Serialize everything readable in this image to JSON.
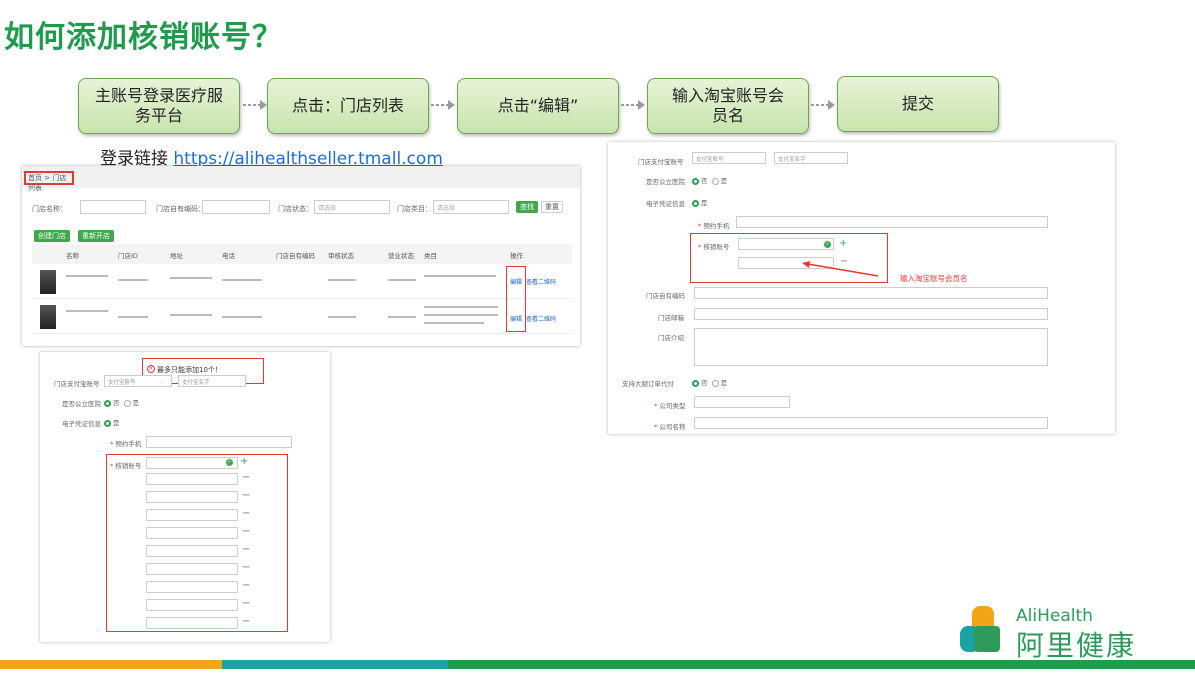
{
  "title": "如何添加核销账号？",
  "steps": [
    "主账号登录医疗服务平台",
    "点击：门店列表",
    "点击“编辑”",
    "输入淘宝账号会员名",
    "提交"
  ],
  "login": {
    "prefix": "登录链接 ",
    "url": "https://alihealthseller.tmall.com"
  },
  "store_list": {
    "breadcrumb": "首页 > 门店列表",
    "filters": {
      "name_label": "门店名称：",
      "code_label": "门店自有编码：",
      "status_label": "门店状态：",
      "status_placeholder": "请选择",
      "category_label": "门店类目：",
      "category_placeholder": "请选择",
      "search_button": "查找",
      "reset_button": "重置"
    },
    "actions": {
      "create": "创建门店",
      "reopen": "重新开店"
    },
    "columns": [
      "名称",
      "门店ID",
      "地址",
      "电话",
      "门店自有编码",
      "审核状态",
      "营业状态",
      "类目",
      "操作"
    ],
    "rows": [
      {
        "edit": "编辑",
        "qrcode": "查看二维码"
      },
      {
        "edit": "编辑",
        "qrcode": "查看二维码"
      }
    ]
  },
  "edit_form_left": {
    "tip": "最多只能添加10个！",
    "alipay_label": "门店支付宝账号",
    "alipay_placeholder": "支付宝账号",
    "alipay_name_placeholder": "支付宝名字",
    "public_hospital_label": "是否公立医院",
    "option_no": "否",
    "option_yes": "是",
    "evoucher_label": "电子凭证信息",
    "phone_label": "预约手机",
    "verify_label": "核销账号"
  },
  "edit_form_right": {
    "alipay_label": "门店支付宝账号",
    "alipay_placeholder": "支付宝账号",
    "alipay_name_placeholder": "支付宝名字",
    "public_hospital_label": "是否公立医院",
    "option_no": "否",
    "option_yes": "是",
    "evoucher_label": "电子凭证信息",
    "phone_label": "预约手机",
    "verify_label": "核销账号",
    "annotation": "输入淘宝账号会员名",
    "code_label": "门店自有编码",
    "email_label": "门店邮箱",
    "intro_label": "门店介绍",
    "support_label": "支持大额订单代付",
    "company_type_label": "公司类型",
    "company_name_label": "公司名称"
  },
  "logo": {
    "en": "AliHealth",
    "cn": "阿里健康"
  },
  "colors": {
    "title_green": "#1f9b4c",
    "step_border": "#6aa84f",
    "highlight_red": "#e53935",
    "bar_orange": "#f2a516",
    "bar_teal": "#1aa3a3",
    "bar_green": "#1f9b4c"
  }
}
